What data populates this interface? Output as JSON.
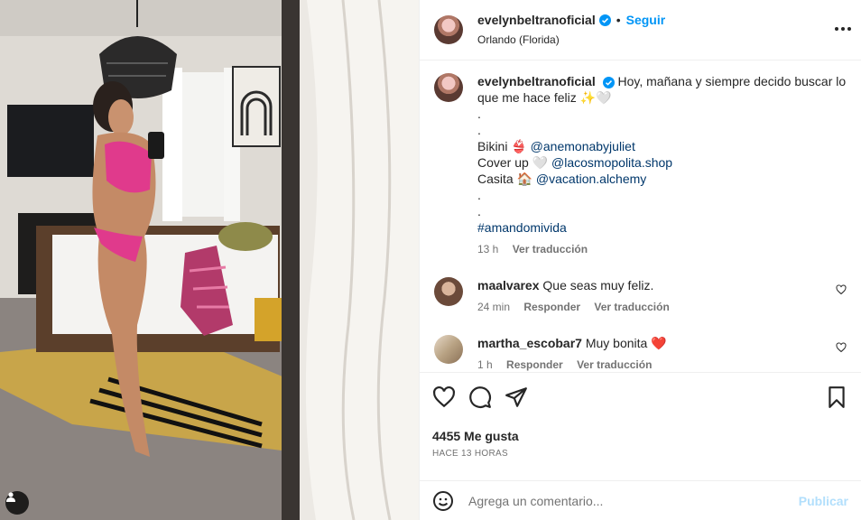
{
  "post": {
    "author": "evelynbeltranoficial",
    "follow_label": "Seguir",
    "dot": "•",
    "location": "Orlando (Florida)"
  },
  "caption": {
    "username": "evelynbeltranoficial",
    "text_first": "Hoy, mañana y siempre decido buscar lo",
    "text_second": "que me hace feliz ✨🤍",
    "dot1": ".",
    "dot2": ".",
    "line_bikini_prefix": "Bikini 👙",
    "line_bikini_handle": "@anemonabyjuliet",
    "line_cover_prefix": "Cover up 🤍",
    "line_cover_handle": "@lacosmopolita.shop",
    "line_casita_prefix": "Casita 🏠",
    "line_casita_handle": "@vacation.alchemy",
    "dot3": ".",
    "dot4": ".",
    "hashtag": "#amandomivida",
    "time": "13 h",
    "translate": "Ver traducción"
  },
  "comments": [
    {
      "username": "maalvarex",
      "text": "Que seas muy feliz.",
      "time": "24 min",
      "reply": "Responder",
      "translate": "Ver traducción"
    },
    {
      "username": "martha_escobar7",
      "text": "Muy bonita",
      "emoji": "❤️",
      "time": "1 h",
      "reply": "Responder",
      "translate": "Ver traducción"
    }
  ],
  "engagement": {
    "likes": "4455 Me gusta",
    "posted": "HACE 13 HORAS"
  },
  "composer": {
    "placeholder": "Agrega un comentario...",
    "publish_label": "Publicar"
  },
  "colors": {
    "accent": "#0095f6",
    "link": "#00376b",
    "heart_red": "#ed2939",
    "muted": "#737373",
    "publish_disabled": "#b2dffc"
  },
  "icons": [
    "verified-icon",
    "more-options-icon",
    "heart-icon",
    "comment-icon",
    "share-icon",
    "save-icon",
    "emoji-icon",
    "user-tag-icon"
  ]
}
